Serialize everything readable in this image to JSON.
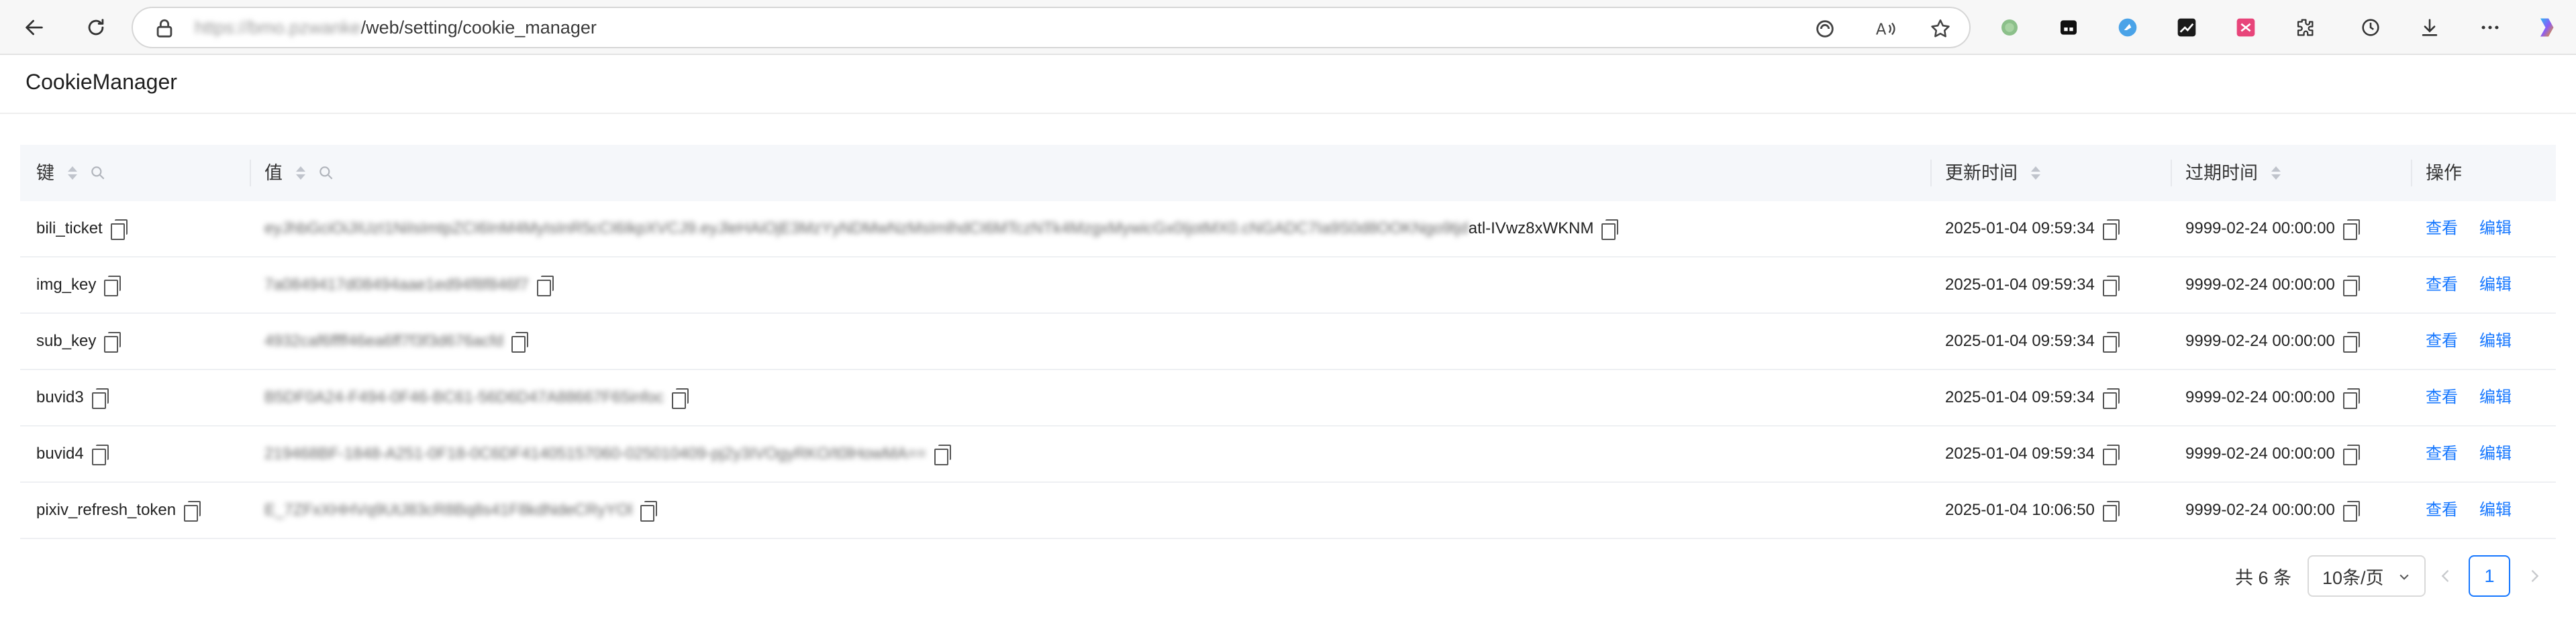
{
  "browser": {
    "url_host": "https://bmo.pzwanke",
    "url_path": "/web/setting/cookie_manager",
    "icons": [
      "back-icon",
      "refresh-icon",
      "lock-icon",
      "edge-tracking-icon",
      "read-aloud-icon",
      "favorite-star-icon",
      "extension-green-dot-icon",
      "extension-dark-icon",
      "extension-blue-bird-icon",
      "extension-chart-icon",
      "extension-pink-icon",
      "extensions-puzzle-icon",
      "history-icon",
      "download-icon",
      "more-icon",
      "copilot-icon"
    ]
  },
  "app": {
    "title": "CookieManager"
  },
  "table": {
    "columns": [
      {
        "label": "键",
        "sortable": true,
        "searchable": true
      },
      {
        "label": "值",
        "sortable": true,
        "searchable": true
      },
      {
        "label": "更新时间",
        "sortable": true,
        "searchable": false
      },
      {
        "label": "过期时间",
        "sortable": true,
        "searchable": false
      },
      {
        "label": "操作",
        "sortable": false,
        "searchable": false
      }
    ],
    "rows": [
      {
        "key": "bili_ticket",
        "value_hidden": "eyJhbGciOiJIUzI1NiIsImtpZCI6InM4MyIsInR5cCI6IkpXVCJ9.eyJleHAiOjE3MzYyNDMwNzMsImlhdCI6MTczNTk4MzgxMywicGx0IjotMX0.cNGADC7Ia9S0d8OOKNgo9tjd",
        "value_visible": "atl-IVwz8xWKNM",
        "updated": "2025-01-04 09:59:34",
        "expires": "9999-02-24 00:00:00"
      },
      {
        "key": "img_key",
        "value_hidden": "7a0849417d08494aae1ed94f8f846f7",
        "value_visible": "",
        "updated": "2025-01-04 09:59:34",
        "expires": "9999-02-24 00:00:00"
      },
      {
        "key": "sub_key",
        "value_hidden": "4932caf6ffff46ea6ff7f3f3d676acfd",
        "value_visible": "",
        "updated": "2025-01-04 09:59:34",
        "expires": "9999-02-24 00:00:00"
      },
      {
        "key": "buvid3",
        "value_hidden": "B5DF0A24-F494-0F46-BC61-56D6D47A88667F65infoc",
        "value_visible": "",
        "updated": "2025-01-04 09:59:34",
        "expires": "9999-02-24 00:00:00"
      },
      {
        "key": "buvid4",
        "value_hidden": "219468BF-1848-A251-0F18-0C6DF41405157060-025010409-pj2y3IVOgyRKO/t0lHowMA==",
        "value_visible": "",
        "updated": "2025-01-04 09:59:34",
        "expires": "9999-02-24 00:00:00"
      },
      {
        "key": "pixiv_refresh_token",
        "value_hidden": "E_7ZFxXHHVq9UtJ83cR8Bq8s41F8kdNdeCRyYOl",
        "value_visible": "",
        "updated": "2025-01-04 10:06:50",
        "expires": "9999-02-24 00:00:00"
      }
    ],
    "actions": {
      "view": "查看",
      "edit": "编辑"
    }
  },
  "pagination": {
    "total_text": "共 6 条",
    "page_size": "10条/页",
    "current_page": "1"
  },
  "colors": {
    "link": "#1677ff",
    "header_bg": "#f5f7fa",
    "border": "#eef0f3"
  }
}
